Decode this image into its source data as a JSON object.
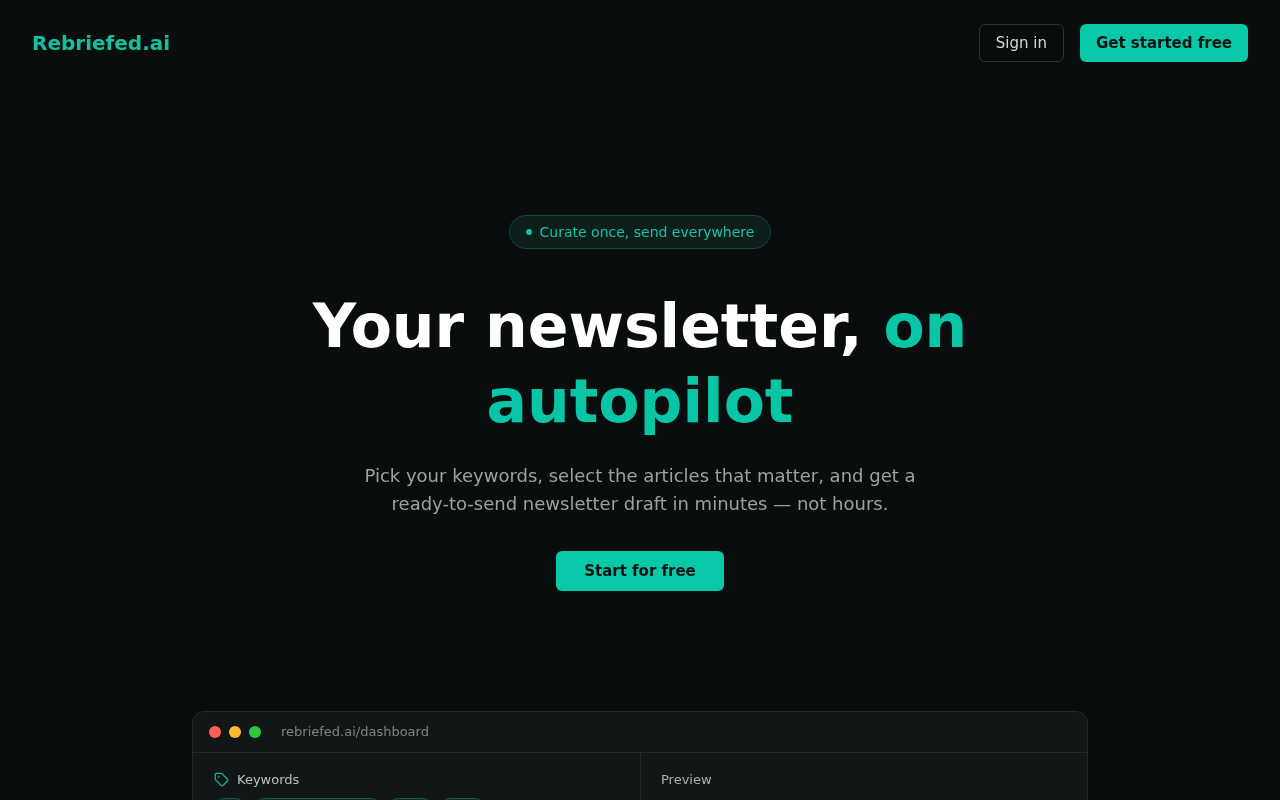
{
  "header": {
    "logo": "Rebriefed.ai",
    "buttons": [
      {
        "label": "Sign in",
        "kind": "outline"
      },
      {
        "label": "Get started free",
        "kind": "primary"
      }
    ]
  },
  "hero": {
    "badge": "Curate once, send everywhere",
    "title": [
      {
        "text": "Your newsletter,",
        "accent": false
      },
      {
        "text": "on autopilot",
        "accent": true
      }
    ],
    "subtitle": "Pick your keywords, select the articles that matter, and get a ready-to-send newsletter draft in minutes — not hours.",
    "cta": "Start for free"
  },
  "dashboard": {
    "dots": [
      {
        "color": "#ff5f57"
      },
      {
        "color": "#febc2e"
      },
      {
        "color": "#28c840"
      }
    ],
    "url": "rebriefed.ai/dashboard",
    "panels": [
      {
        "kind": "keywords",
        "title": "Keywords"
      },
      {
        "kind": "preview",
        "title": "Preview"
      }
    ]
  }
}
